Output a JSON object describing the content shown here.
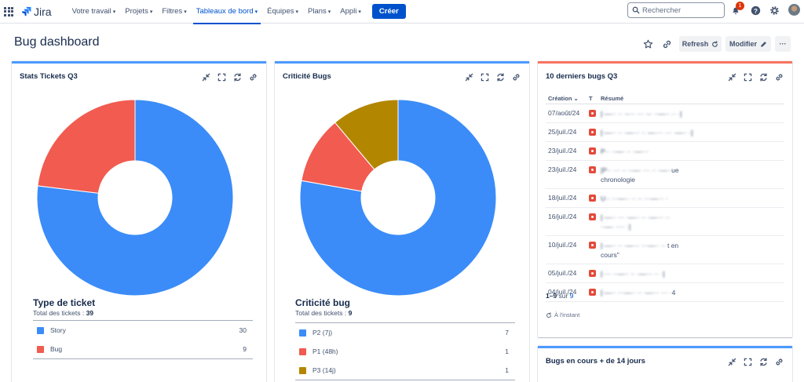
{
  "nav": {
    "product": "Jira",
    "items": [
      {
        "label": "Votre travail",
        "active": false
      },
      {
        "label": "Projets",
        "active": false
      },
      {
        "label": "Filtres",
        "active": false
      },
      {
        "label": "Tableaux de bord",
        "active": true
      },
      {
        "label": "Équipes",
        "active": false
      },
      {
        "label": "Plans",
        "active": false
      },
      {
        "label": "Appli",
        "active": false
      }
    ],
    "create_label": "Créer",
    "search_placeholder": "Rechercher",
    "notifications_count": "1"
  },
  "page": {
    "title": "Bug dashboard",
    "refresh_label": "Refresh",
    "edit_label": "Modifier",
    "more_label": "···"
  },
  "colors": {
    "accent": "#0052cc",
    "blue": "#2684ff",
    "red": "#f15b50",
    "gold": "#b38600"
  },
  "gadget1": {
    "title": "Stats Tickets Q3",
    "legend_title": "Type de ticket",
    "total_label": "Total des tickets : ",
    "total": "39",
    "chart_data": {
      "type": "pie",
      "categories": [
        "Story",
        "Bug"
      ],
      "values": [
        30,
        9
      ],
      "colors": [
        "#3b8cf8",
        "#f15b50"
      ]
    },
    "rows": [
      {
        "label": "Story",
        "count": "30",
        "color": "#3b8cf8"
      },
      {
        "label": "Bug",
        "count": "9",
        "color": "#f15b50"
      }
    ]
  },
  "gadget2": {
    "title": "Criticité Bugs",
    "legend_title": "Criticité bug",
    "total_label": "Total des tickets : ",
    "total": "9",
    "chart_data": {
      "type": "pie",
      "categories": [
        "P2 (7j)",
        "P1 (48h)",
        "P3 (14j)"
      ],
      "values": [
        7,
        1,
        1
      ],
      "colors": [
        "#3b8cf8",
        "#f15b50",
        "#b38600"
      ]
    },
    "rows": [
      {
        "label": "P2 (7j)",
        "count": "7",
        "color": "#3b8cf8"
      },
      {
        "label": "P1 (48h)",
        "count": "1",
        "color": "#f15b50"
      },
      {
        "label": "P3 (14j)",
        "count": "1",
        "color": "#b38600"
      }
    ]
  },
  "gadget3": {
    "title": "10 derniers bugs Q3",
    "col_creation": "Création",
    "col_type": "T",
    "col_summary": "Résumé",
    "rows": [
      {
        "date": "07/août/24",
        "summary_visible": "",
        "summary_tail": ""
      },
      {
        "date": "25/juil./24",
        "summary_visible": "",
        "summary_tail": ""
      },
      {
        "date": "23/juil./24",
        "summary_visible": "",
        "summary_tail": ""
      },
      {
        "date": "23/juil./24",
        "summary_visible": "chronologie",
        "summary_tail": "ue"
      },
      {
        "date": "18/juil./24",
        "summary_visible": "",
        "summary_tail": ""
      },
      {
        "date": "16/juil./24",
        "summary_visible": "",
        "summary_tail": ""
      },
      {
        "date": "10/juil./24",
        "summary_visible": "cours\"",
        "summary_tail": "t en"
      },
      {
        "date": "05/juil./24",
        "summary_visible": "",
        "summary_tail": ""
      },
      {
        "date": "04/juil./24",
        "summary_visible": "",
        "summary_tail": "4"
      }
    ],
    "paging_range": "1–9",
    "paging_sep": " sur ",
    "paging_total": "9",
    "updated": "À l'instant"
  },
  "gadget4": {
    "title": "Bugs en cours + de 14 jours"
  }
}
